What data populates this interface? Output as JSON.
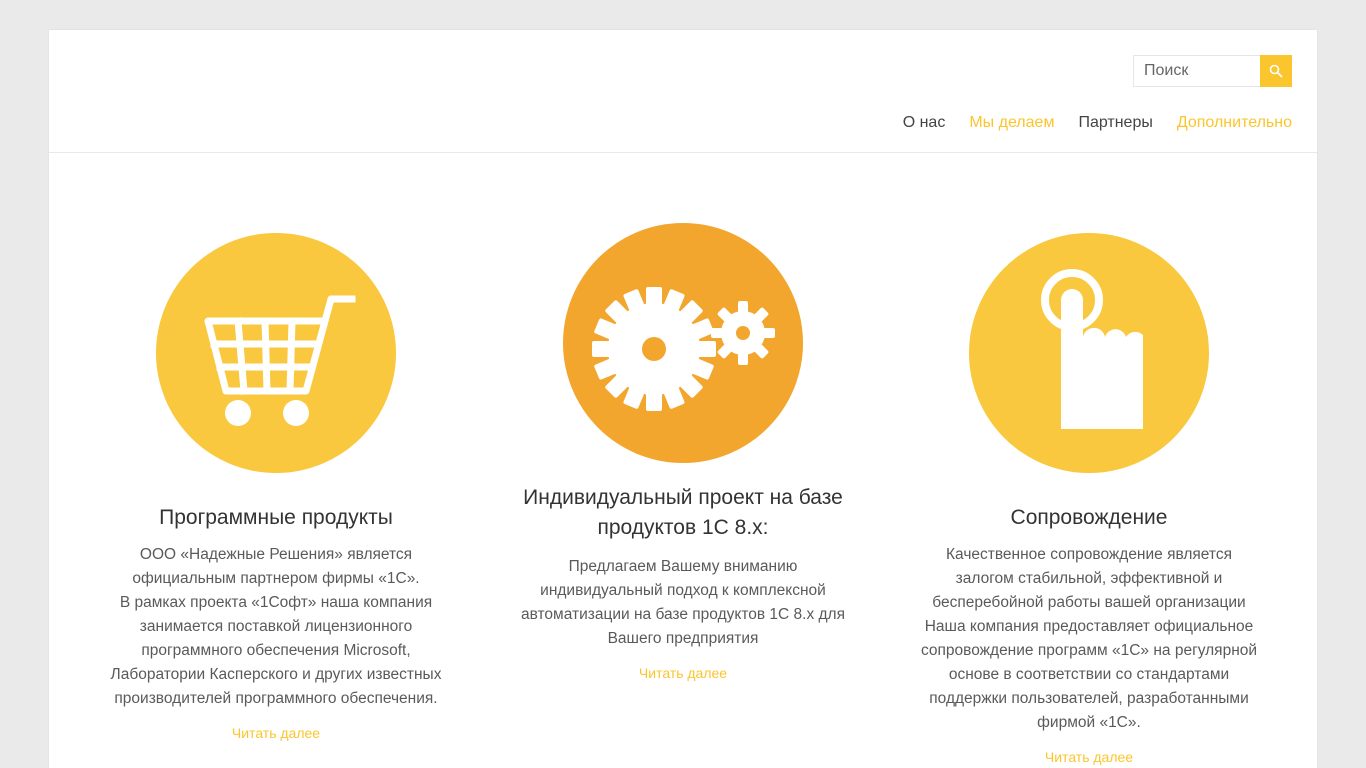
{
  "search": {
    "placeholder": "Поиск"
  },
  "nav": {
    "items": [
      {
        "label": "О нас",
        "color": "#444444"
      },
      {
        "label": "Мы делаем",
        "color": "#fbc52d"
      },
      {
        "label": "Партнеры",
        "color": "#444444"
      },
      {
        "label": "Дополнительно",
        "color": "#fbc52d"
      }
    ]
  },
  "colors": {
    "accent": "#fbc52d",
    "circle_yellow": "#f9c83e",
    "circle_orange": "#f3a62d"
  },
  "features": [
    {
      "icon": "shopping-cart-icon",
      "title": "Программные продукты",
      "text": [
        "ООО «Надежные Решения» является",
        "официальным партнером фирмы «1С».",
        "В рамках проекта «1Софт» наша компания",
        "занимается поставкой лицензионного",
        "программного обеспечения Microsoft,",
        "Лаборатории Касперского и других известных",
        "производителей программного обеспечения."
      ],
      "read_more": "Читать далее"
    },
    {
      "icon": "gears-icon",
      "title_lines": [
        "Индивидуальный проект на базе",
        "продуктов 1С 8.x:"
      ],
      "text": [
        "Предлагаем Вашему вниманию",
        "индивидуальный подход к комплексной",
        "автоматизации на базе продуктов 1С 8.x для",
        "Вашего предприятия"
      ],
      "read_more": "Читать далее"
    },
    {
      "icon": "pointing-hand-icon",
      "title": "Сопровождение",
      "text": [
        "Качественное сопровождение является",
        "залогом стабильной, эффективной и",
        "бесперебойной работы вашей организации",
        "Наша компания предоставляет официальное",
        "сопровождение программ «1С» на регулярной",
        "основе в соответствии со стандартами",
        "поддержки пользователей, разработанными",
        "фирмой «1С»."
      ],
      "read_more": "Читать далее"
    }
  ]
}
